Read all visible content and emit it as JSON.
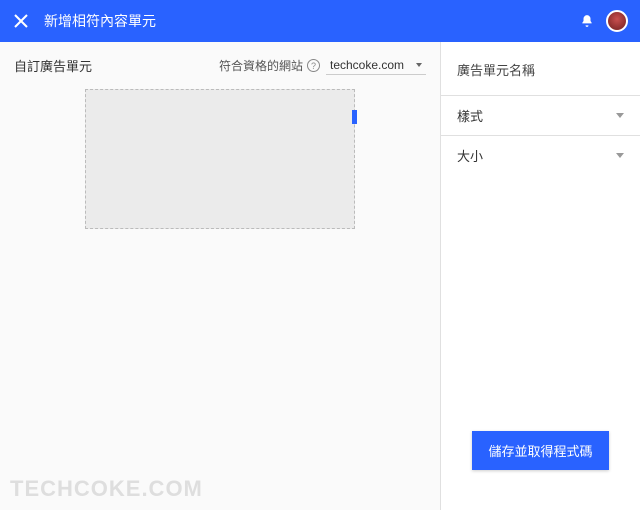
{
  "header": {
    "title": "新增相符內容單元"
  },
  "left": {
    "custom_label": "自訂廣告單元",
    "eligible_label": "符合資格的網站",
    "site": "techcoke.com"
  },
  "right": {
    "unit_name_label": "廣告單元名稱",
    "style_label": "樣式",
    "size_label": "大小",
    "save_label": "儲存並取得程式碼"
  },
  "watermark": "TECHCOKE.COM"
}
